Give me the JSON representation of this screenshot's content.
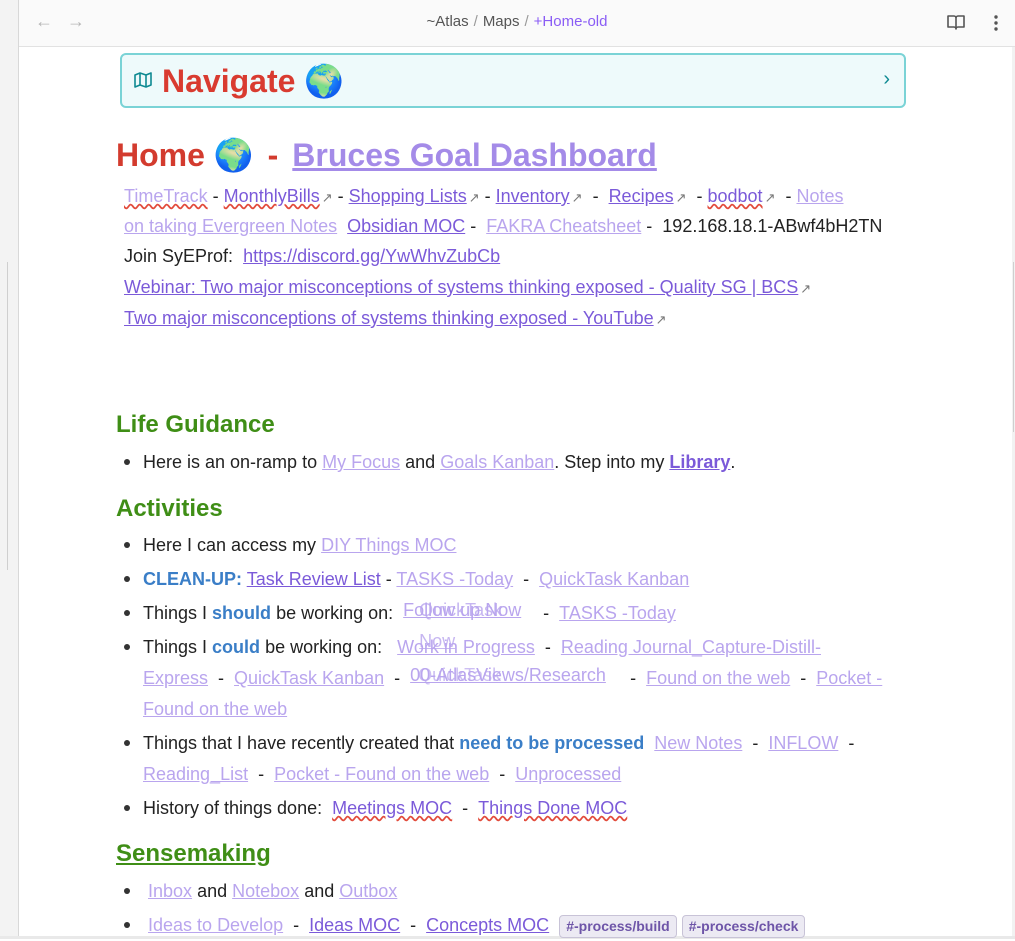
{
  "topbar": {
    "back_icon": "arrow-left-icon",
    "forward_icon": "arrow-right-icon",
    "breadcrumb": [
      "~Atlas",
      "Maps",
      "+Home-old"
    ],
    "reading_icon": "book-open-icon",
    "more_icon": "more-vertical-icon"
  },
  "callout": {
    "icon": "map-icon",
    "title": "Navigate 🌍",
    "chevron": "chevron-right-icon"
  },
  "heading": {
    "home": "Home 🌍",
    "dash": "-",
    "dashboard_link": "Bruces Goal Dashboard"
  },
  "links_row1": {
    "timetrack": "TimeTrack",
    "monthlybills": "MonthlyBills",
    "shopping": "Shopping Lists",
    "inventory": "Inventory",
    "recipes": "Recipes",
    "bodbot": "bodbot",
    "notes_a": "Notes",
    "notes_b": "on taking Evergreen Notes",
    "obsidian": "Obsidian MOC",
    "fakra": "FAKRA Cheatsheet",
    "ip": "192.168.18.1-ABwf4bH2TN"
  },
  "join_row": {
    "label": "Join SyEProf:",
    "link": "https://discord.gg/YwWhvZubCb"
  },
  "webinar_link": "Webinar: Two major misconceptions of systems thinking exposed - Quality SG | BCS",
  "youtube_link": "Two major misconceptions of systems thinking exposed - YouTube",
  "sections": {
    "life": "Life Guidance",
    "activities": "Activities",
    "sense": "Sensemaking"
  },
  "life": {
    "t1": "Here is an on-ramp to",
    "l1": "My Focus",
    "t2": "and",
    "l2": "Goals Kanban",
    "t3": ". Step into my",
    "l3": "Library",
    "t4": "."
  },
  "act": {
    "diy_pre": "Here I can access my",
    "diy": "DIY Things MOC",
    "clean_label": "CLEAN-UP:",
    "task_review": "Task Review List",
    "tasks_today": "TASKS -Today",
    "quicktask_kanban": "QuickTask Kanban",
    "should_pre": "Things I",
    "should": "should",
    "should_post": "be working on:",
    "follow_up": "Follow up Now",
    "quicktask_now": "QuickTask Now",
    "could_pre": "Things I",
    "could": "could",
    "could_post": "be working on:",
    "wip": "Work in Progress",
    "reading_journal": "Reading Journal_Capture-Distill-",
    "express": "Express",
    "quicktask_kanban2": "QuickTask Kanban",
    "atlas_research": "00-AtlasViews/Research",
    "quicktask_a": "QuickTask",
    "found_web": "Found on the web",
    "pocket": "Pocket -",
    "pocket2": "Found on the web",
    "created_pre": "Things that I have recently created that",
    "need": "need to be processed",
    "new_notes": "New Notes",
    "inflow": "INFLOW",
    "reading_list": "Reading_List",
    "pocket_found": "Pocket - Found on the web",
    "unprocessed": "Unprocessed",
    "history_pre": "History of things done:",
    "meetings": "Meetings MOC",
    "things_done": "Things Done MOC"
  },
  "sense": {
    "inbox": "Inbox",
    "and1": "and",
    "notebox": "Notebox",
    "and2": "and",
    "outbox": "Outbox",
    "ideas_dev": "Ideas to Develop",
    "ideas_moc": "Ideas MOC",
    "concepts": "Concepts MOC",
    "tag1": "#-process/build",
    "tag2": "#-process/check"
  }
}
